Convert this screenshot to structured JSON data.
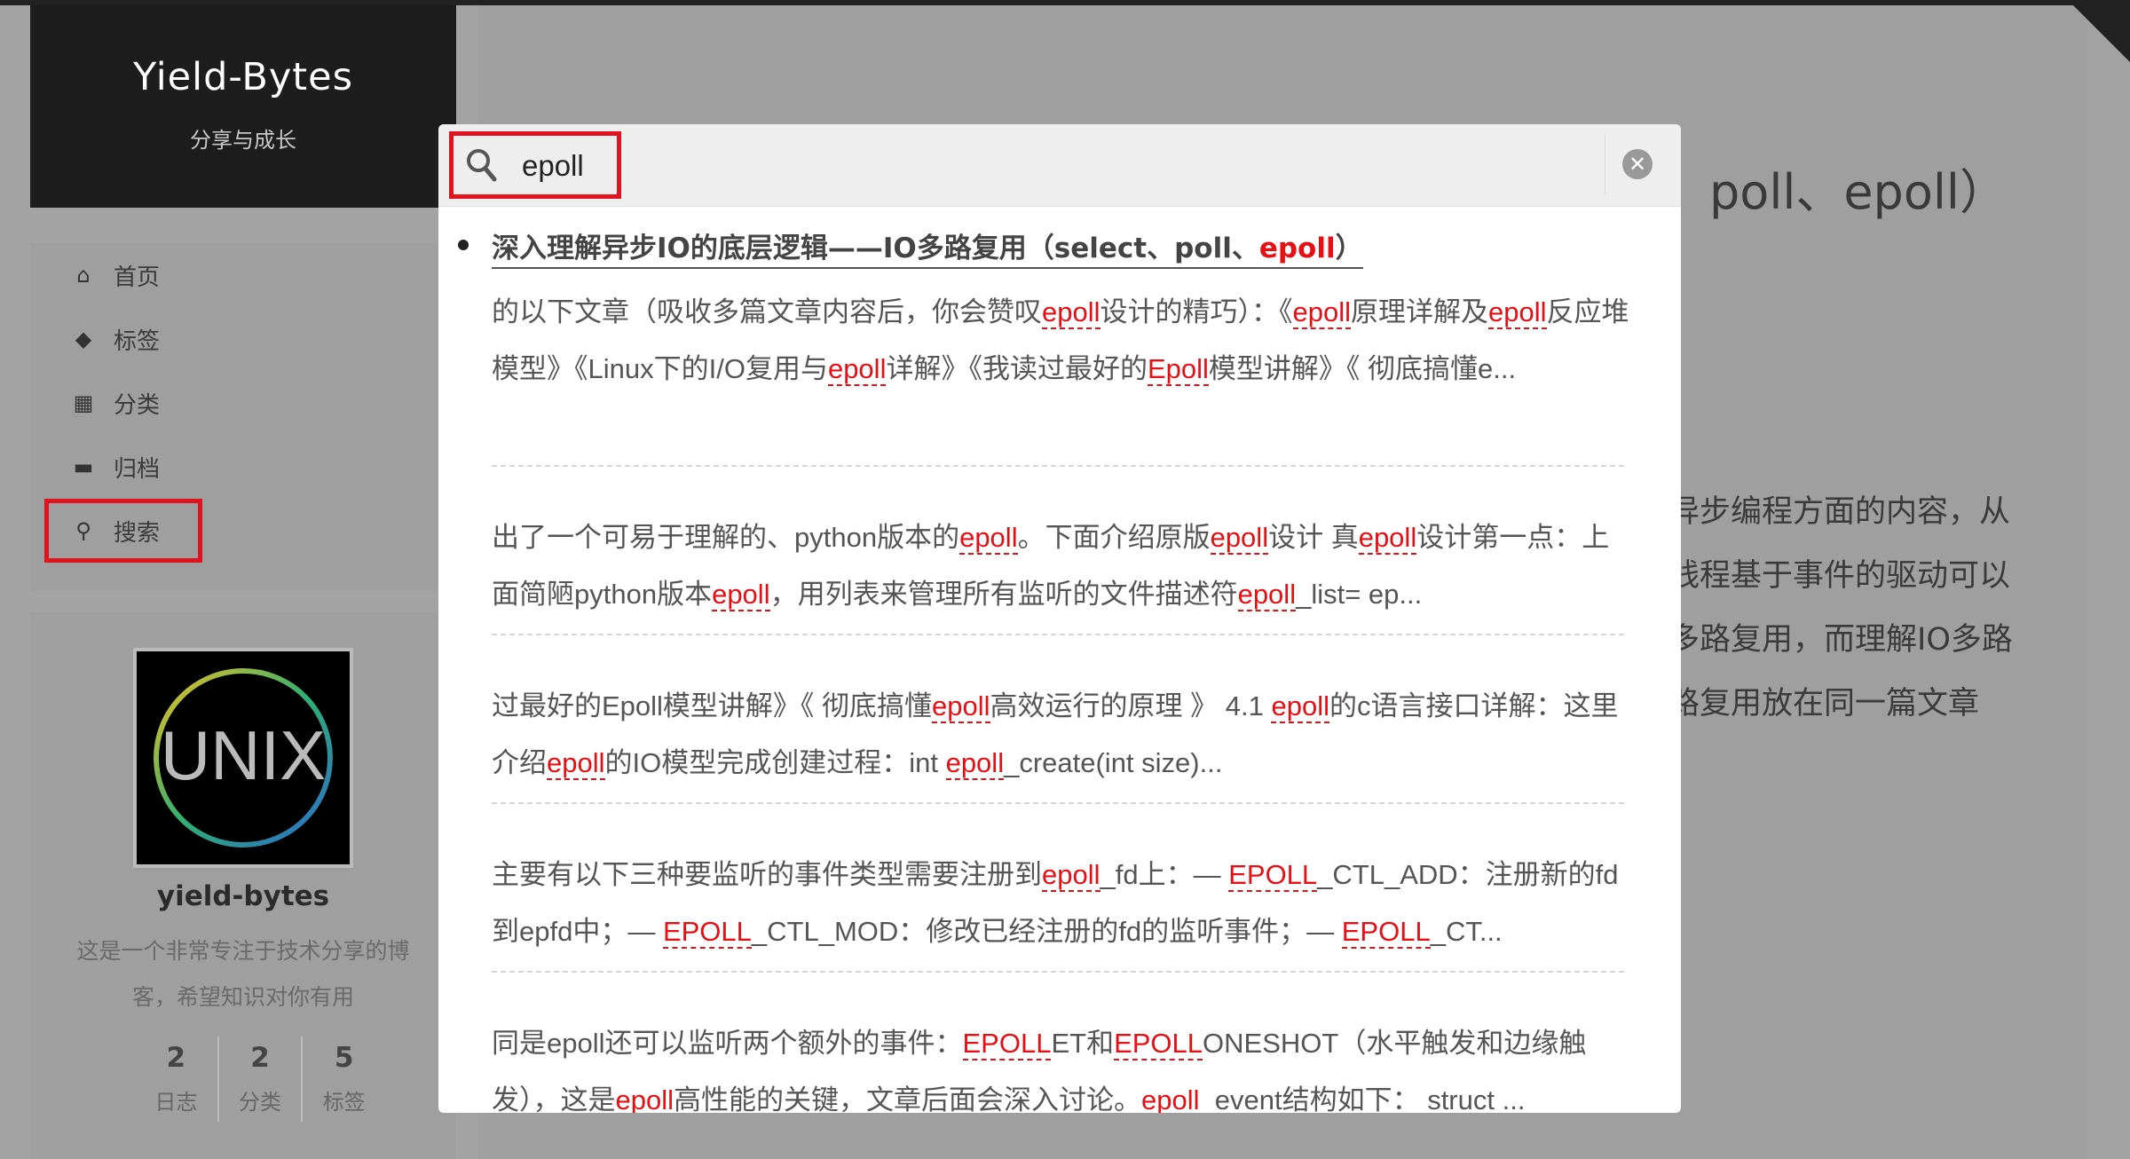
{
  "site": {
    "title": "Yield-Bytes",
    "subtitle": "分享与成长"
  },
  "menu": [
    {
      "label": "首页",
      "icon": "home-icon"
    },
    {
      "label": "标签",
      "icon": "tags-icon"
    },
    {
      "label": "分类",
      "icon": "th-icon"
    },
    {
      "label": "归档",
      "icon": "archive-icon"
    },
    {
      "label": "搜索",
      "icon": "search-icon"
    }
  ],
  "overview": {
    "avatar_text": "UNIX",
    "author": "yield-bytes",
    "description": "这是一个非常专注于技术分享的博客，希望知识对你有用",
    "stats": [
      {
        "count": "2",
        "label": "日志"
      },
      {
        "count": "2",
        "label": "分类"
      },
      {
        "count": "5",
        "label": "标签"
      }
    ]
  },
  "background_post": {
    "title_fragment": "poll、epoll）",
    "lines": [
      "异步编程方面的内容，从",
      "线程基于事件的驱动可以",
      "多路复用，而理解IO多路",
      "路复用放在同一篇文章"
    ]
  },
  "search": {
    "query": "epoll",
    "result_title": "深入理解异步IO的底层逻辑——IO多路复用（select、poll、epoll）",
    "snippets": [
      "的以下文章（吸收多篇文章内容后，你会赞叹<em>epoll</em>设计的精巧）：《<em>epoll</em>原理详解及<em>epoll</em>反应堆模型》《Linux下的I/O复用与<em>epoll</em>详解》《我读过最好的<em>Epoll</em>模型讲解》《 彻底搞懂e...",
      "出了一个可易于理解的、python版本的<em>epoll</em>。下面介绍原版<em>epoll</em>设计 真<em>epoll</em>设计第一点：上面简陋python版本<em>epoll</em>，用列表来管理所有监听的文件描述符<em>epoll</em>_list= ep...",
      "过最好的Epoll模型讲解》《 彻底搞懂<em>epoll</em>高效运行的原理 》 4.1 <em>epoll</em>的c语言接口详解：这里介绍<em>epoll</em>的IO模型完成创建过程：int <em>epoll</em>_create(int size)...",
      "主要有以下三种要监听的事件类型需要注册到<em>epoll</em>_fd上：— <em>EPOLL</em>_CTL_ADD：注册新的fd到epfd中；— <em>EPOLL</em>_CTL_MOD：修改已经注册的fd的监听事件；— <em>EPOLL</em>_CT...",
      "同是epoll还可以监听两个额外的事件：<em>EPOLL</em>ET和<em>EPOLL</em>ONESHOT（水平触发和边缘触发），这是<em>epoll</em>高性能的关键，文章后面会深入讨论。<em>epoll</em>_event结构如下： struct ..."
    ]
  }
}
